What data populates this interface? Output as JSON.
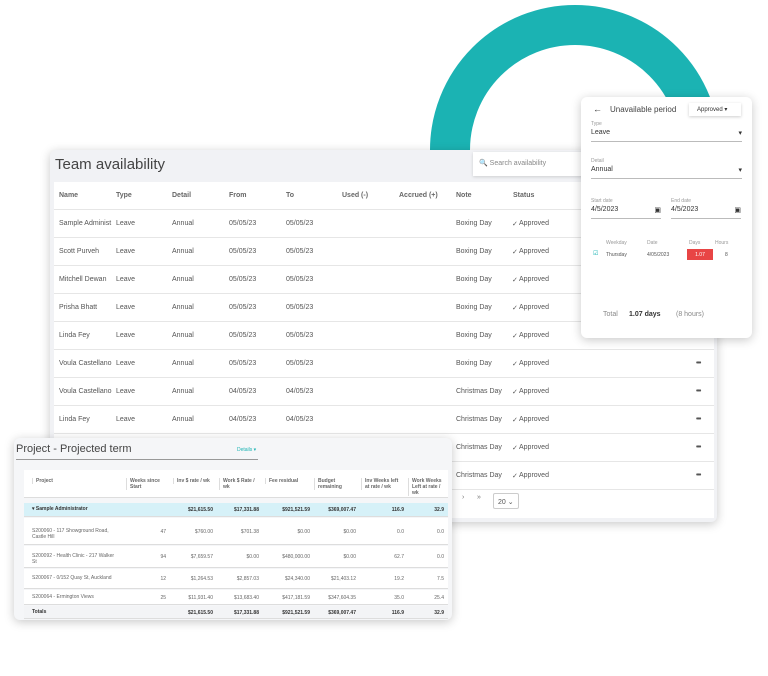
{
  "colors": {
    "accent": "#1bb3b3",
    "highlight": "#d6f1f8",
    "days_red": "#e84545"
  },
  "team": {
    "title": "Team availability",
    "search_placeholder": "Search availability",
    "columns": [
      "Name",
      "Type",
      "Detail",
      "From",
      "To",
      "Used (-)",
      "Accrued (+)",
      "Note",
      "Status"
    ],
    "rows": [
      {
        "name": "Sample Administ",
        "type": "Leave",
        "detail": "Annual",
        "from": "05/05/23",
        "to": "05/05/23",
        "note": "Boxing Day",
        "status": "Approved"
      },
      {
        "name": "Scott Purveh",
        "type": "Leave",
        "detail": "Annual",
        "from": "05/05/23",
        "to": "05/05/23",
        "note": "Boxing Day",
        "status": "Approved"
      },
      {
        "name": "Mitchell Dewan",
        "type": "Leave",
        "detail": "Annual",
        "from": "05/05/23",
        "to": "05/05/23",
        "note": "Boxing Day",
        "status": "Approved"
      },
      {
        "name": "Prisha Bhatt",
        "type": "Leave",
        "detail": "Annual",
        "from": "05/05/23",
        "to": "05/05/23",
        "note": "Boxing Day",
        "status": "Approved"
      },
      {
        "name": "Linda Fey",
        "type": "Leave",
        "detail": "Annual",
        "from": "05/05/23",
        "to": "05/05/23",
        "note": "Boxing Day",
        "status": "Approved"
      },
      {
        "name": "Voula Castellano",
        "type": "Leave",
        "detail": "Annual",
        "from": "05/05/23",
        "to": "05/05/23",
        "note": "Boxing Day",
        "status": "Approved"
      },
      {
        "name": "Voula Castellano",
        "type": "Leave",
        "detail": "Annual",
        "from": "04/05/23",
        "to": "04/05/23",
        "note": "Christmas Day",
        "status": "Approved"
      },
      {
        "name": "Linda Fey",
        "type": "Leave",
        "detail": "Annual",
        "from": "04/05/23",
        "to": "04/05/23",
        "note": "Christmas Day",
        "status": "Approved"
      },
      {
        "name": "",
        "type": "",
        "detail": "",
        "from": "",
        "to": "",
        "note": "Christmas Day",
        "status": "Approved"
      },
      {
        "name": "",
        "type": "",
        "detail": "",
        "from": "",
        "to": "",
        "note": "Christmas Day",
        "status": "Approved"
      }
    ],
    "more_label": "•••",
    "pager": {
      "next": "›",
      "last": "»",
      "page_size": "20"
    }
  },
  "unavailable": {
    "title": "Unavailable period",
    "status": "Approved",
    "type_label": "Type",
    "type_value": "Leave",
    "detail_label": "Detail",
    "detail_value": "Annual",
    "start_label": "Start date",
    "start_value": "4/5/2023",
    "end_label": "End date",
    "end_value": "4/5/2023",
    "columns": [
      "Weekday",
      "Date",
      "Days",
      "Hours"
    ],
    "row": {
      "weekday": "Thursday",
      "date": "4/05/2023",
      "days": "1.07",
      "hours": "8"
    },
    "total_label": "Total",
    "total_days": "1.07 days",
    "total_hours": "(8 hours)"
  },
  "project": {
    "title": "Project - Projected term",
    "details_label": "Details ▾",
    "columns": [
      "Project",
      "Weeks since Start",
      "Inv $ rate / wk",
      "Work $ Rate / wk",
      "Fee residual",
      "Budget remaining",
      "Inv Weeks left at rate / wk",
      "Work Weeks Left at rate / wk"
    ],
    "group": {
      "name": "▾ Sample Administrator",
      "values": [
        "",
        "$21,615.50",
        "$17,331.88",
        "$921,521.59",
        "$369,007.47",
        "116.9",
        "32.9"
      ]
    },
    "rows": [
      {
        "name": "S200060 - 117 Showground Road, Castle Hill",
        "values": [
          "47",
          "$760.00",
          "$701.38",
          "$0.00",
          "$0.00",
          "0.0",
          "0.0"
        ]
      },
      {
        "name": "S200092 - Health Clinic - 217 Walker St",
        "values": [
          "94",
          "$7,659.57",
          "$0.00",
          "$480,000.00",
          "$0.00",
          "62.7",
          "0.0"
        ]
      },
      {
        "name": "S200067 - 0/152 Quay St, Auckland",
        "values": [
          "12",
          "$1,264.53",
          "$2,857.03",
          "$24,340.00",
          "$21,403.12",
          "19.2",
          "7.5"
        ]
      },
      {
        "name": "S200064 - Ermington Views",
        "values": [
          "25",
          "$11,931.40",
          "$13,683.40",
          "$417,181.59",
          "$347,604.35",
          "35.0",
          "25.4"
        ]
      }
    ],
    "totals": {
      "name": "Totals",
      "values": [
        "",
        "$21,615.50",
        "$17,331.88",
        "$921,521.59",
        "$369,007.47",
        "116.9",
        "32.9"
      ]
    }
  }
}
